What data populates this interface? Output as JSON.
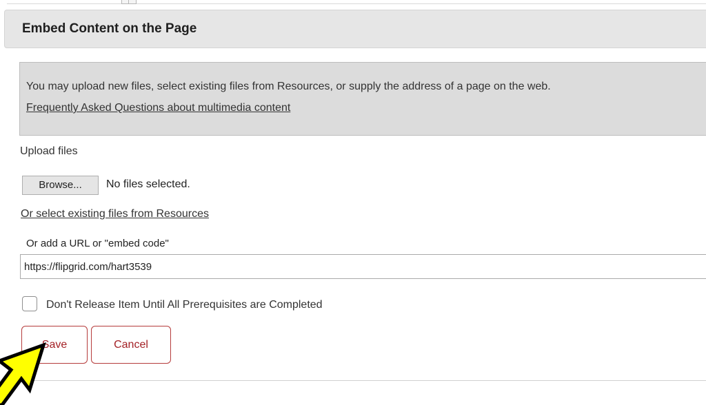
{
  "dialog": {
    "title": "Embed Content on the Page"
  },
  "info": {
    "text": "You may upload new files, select existing files from Resources, or supply the address of a page on the web.",
    "faq_link": "Frequently Asked Questions about multimedia content"
  },
  "upload": {
    "label": "Upload files",
    "browse_label": "Browse...",
    "status": "No files selected."
  },
  "resources_link": "Or select existing files from Resources",
  "url": {
    "label": "Or add a URL or \"embed code\"",
    "value": "https://flipgrid.com/hart3539"
  },
  "prerequisite": {
    "label": "Don't Release Item Until All Prerequisites are Completed",
    "checked": false
  },
  "actions": {
    "save_label": "Save",
    "cancel_label": "Cancel"
  },
  "annotation": {
    "icon": "arrow-pointer-icon",
    "color": "#ffff00"
  }
}
